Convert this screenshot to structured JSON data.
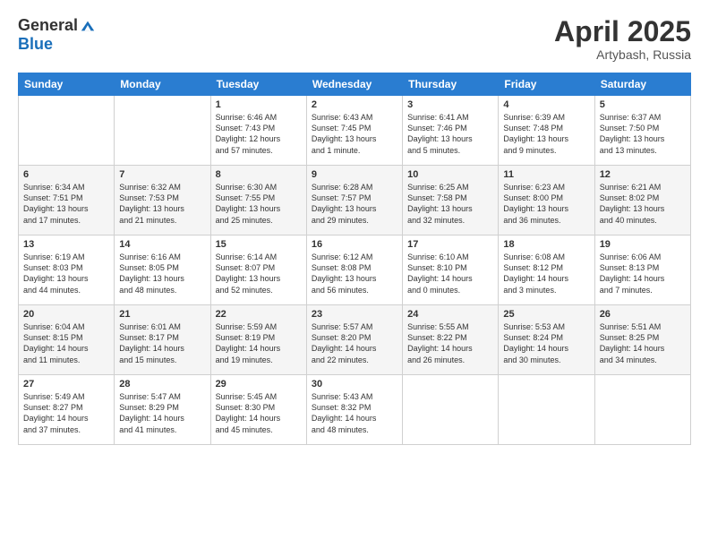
{
  "header": {
    "logo_general": "General",
    "logo_blue": "Blue",
    "title": "April 2025",
    "location": "Artybash, Russia"
  },
  "weekdays": [
    "Sunday",
    "Monday",
    "Tuesday",
    "Wednesday",
    "Thursday",
    "Friday",
    "Saturday"
  ],
  "weeks": [
    [
      {
        "day": "",
        "info": ""
      },
      {
        "day": "",
        "info": ""
      },
      {
        "day": "1",
        "info": "Sunrise: 6:46 AM\nSunset: 7:43 PM\nDaylight: 12 hours\nand 57 minutes."
      },
      {
        "day": "2",
        "info": "Sunrise: 6:43 AM\nSunset: 7:45 PM\nDaylight: 13 hours\nand 1 minute."
      },
      {
        "day": "3",
        "info": "Sunrise: 6:41 AM\nSunset: 7:46 PM\nDaylight: 13 hours\nand 5 minutes."
      },
      {
        "day": "4",
        "info": "Sunrise: 6:39 AM\nSunset: 7:48 PM\nDaylight: 13 hours\nand 9 minutes."
      },
      {
        "day": "5",
        "info": "Sunrise: 6:37 AM\nSunset: 7:50 PM\nDaylight: 13 hours\nand 13 minutes."
      }
    ],
    [
      {
        "day": "6",
        "info": "Sunrise: 6:34 AM\nSunset: 7:51 PM\nDaylight: 13 hours\nand 17 minutes."
      },
      {
        "day": "7",
        "info": "Sunrise: 6:32 AM\nSunset: 7:53 PM\nDaylight: 13 hours\nand 21 minutes."
      },
      {
        "day": "8",
        "info": "Sunrise: 6:30 AM\nSunset: 7:55 PM\nDaylight: 13 hours\nand 25 minutes."
      },
      {
        "day": "9",
        "info": "Sunrise: 6:28 AM\nSunset: 7:57 PM\nDaylight: 13 hours\nand 29 minutes."
      },
      {
        "day": "10",
        "info": "Sunrise: 6:25 AM\nSunset: 7:58 PM\nDaylight: 13 hours\nand 32 minutes."
      },
      {
        "day": "11",
        "info": "Sunrise: 6:23 AM\nSunset: 8:00 PM\nDaylight: 13 hours\nand 36 minutes."
      },
      {
        "day": "12",
        "info": "Sunrise: 6:21 AM\nSunset: 8:02 PM\nDaylight: 13 hours\nand 40 minutes."
      }
    ],
    [
      {
        "day": "13",
        "info": "Sunrise: 6:19 AM\nSunset: 8:03 PM\nDaylight: 13 hours\nand 44 minutes."
      },
      {
        "day": "14",
        "info": "Sunrise: 6:16 AM\nSunset: 8:05 PM\nDaylight: 13 hours\nand 48 minutes."
      },
      {
        "day": "15",
        "info": "Sunrise: 6:14 AM\nSunset: 8:07 PM\nDaylight: 13 hours\nand 52 minutes."
      },
      {
        "day": "16",
        "info": "Sunrise: 6:12 AM\nSunset: 8:08 PM\nDaylight: 13 hours\nand 56 minutes."
      },
      {
        "day": "17",
        "info": "Sunrise: 6:10 AM\nSunset: 8:10 PM\nDaylight: 14 hours\nand 0 minutes."
      },
      {
        "day": "18",
        "info": "Sunrise: 6:08 AM\nSunset: 8:12 PM\nDaylight: 14 hours\nand 3 minutes."
      },
      {
        "day": "19",
        "info": "Sunrise: 6:06 AM\nSunset: 8:13 PM\nDaylight: 14 hours\nand 7 minutes."
      }
    ],
    [
      {
        "day": "20",
        "info": "Sunrise: 6:04 AM\nSunset: 8:15 PM\nDaylight: 14 hours\nand 11 minutes."
      },
      {
        "day": "21",
        "info": "Sunrise: 6:01 AM\nSunset: 8:17 PM\nDaylight: 14 hours\nand 15 minutes."
      },
      {
        "day": "22",
        "info": "Sunrise: 5:59 AM\nSunset: 8:19 PM\nDaylight: 14 hours\nand 19 minutes."
      },
      {
        "day": "23",
        "info": "Sunrise: 5:57 AM\nSunset: 8:20 PM\nDaylight: 14 hours\nand 22 minutes."
      },
      {
        "day": "24",
        "info": "Sunrise: 5:55 AM\nSunset: 8:22 PM\nDaylight: 14 hours\nand 26 minutes."
      },
      {
        "day": "25",
        "info": "Sunrise: 5:53 AM\nSunset: 8:24 PM\nDaylight: 14 hours\nand 30 minutes."
      },
      {
        "day": "26",
        "info": "Sunrise: 5:51 AM\nSunset: 8:25 PM\nDaylight: 14 hours\nand 34 minutes."
      }
    ],
    [
      {
        "day": "27",
        "info": "Sunrise: 5:49 AM\nSunset: 8:27 PM\nDaylight: 14 hours\nand 37 minutes."
      },
      {
        "day": "28",
        "info": "Sunrise: 5:47 AM\nSunset: 8:29 PM\nDaylight: 14 hours\nand 41 minutes."
      },
      {
        "day": "29",
        "info": "Sunrise: 5:45 AM\nSunset: 8:30 PM\nDaylight: 14 hours\nand 45 minutes."
      },
      {
        "day": "30",
        "info": "Sunrise: 5:43 AM\nSunset: 8:32 PM\nDaylight: 14 hours\nand 48 minutes."
      },
      {
        "day": "",
        "info": ""
      },
      {
        "day": "",
        "info": ""
      },
      {
        "day": "",
        "info": ""
      }
    ]
  ]
}
